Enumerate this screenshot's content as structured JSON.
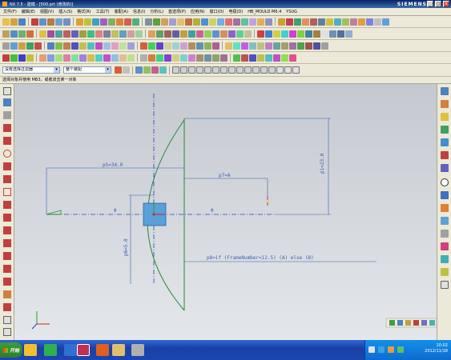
{
  "window": {
    "title": "NX 7.5 - 建模 - [500.prt (修改的)]",
    "brand": "SIEMENS",
    "controls": [
      "_",
      "□",
      "×"
    ]
  },
  "menubar": {
    "items": [
      "文件(F)",
      "编辑(E)",
      "视图(V)",
      "插入(S)",
      "格式(R)",
      "工具(T)",
      "装配(A)",
      "信息(I)",
      "分析(L)",
      "首选项(P)",
      "应用(N)",
      "窗口(O)",
      "电极(D)",
      "HB_MOULD M6.4",
      "YSUG"
    ]
  },
  "toolbar": {
    "filter_select": "没有选择过滤器",
    "scope_select": "整个装配"
  },
  "cue_line": "选择对象并使用 MB3，或者双击某一对象",
  "sketch": {
    "dimensions": {
      "p5": "p5=34.0",
      "p7": "p7=A",
      "p1": "p1=23.0",
      "p6": "p6=5.0",
      "p8": "p8=if (FrameNumber<12.5) (A) else (B)"
    },
    "colors": {
      "centerline": "#2a3fc0",
      "curve": "#1f8a3a",
      "dimension": "#3a5fb0",
      "square_fill": "#5aa0d8",
      "background_top": "#c4c9cf",
      "background_bottom": "#e4e7ea"
    }
  },
  "taskbar": {
    "start_label": "开始",
    "clock_time": "10:02",
    "clock_date": "2012/11/18"
  }
}
